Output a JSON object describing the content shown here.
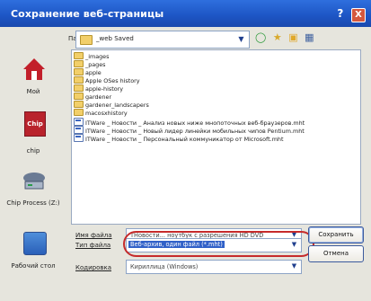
{
  "window": {
    "title": "Сохранение веб-страницы",
    "help": "?",
    "close": "X"
  },
  "lookin": {
    "label": "Папка",
    "value": "_web Saved"
  },
  "places": [
    {
      "label": "Мой",
      "icon": "home-icon"
    },
    {
      "label": "chip",
      "icon": "chip-icon"
    },
    {
      "label": "Chip Process (Z:)",
      "icon": "computer-icon"
    },
    {
      "label": "Рабочий стол",
      "icon": "desktop-icon"
    }
  ],
  "files": [
    {
      "type": "folder",
      "name": "_images"
    },
    {
      "type": "folder",
      "name": "_pages"
    },
    {
      "type": "folder",
      "name": "apple"
    },
    {
      "type": "folder",
      "name": "Apple OSes history"
    },
    {
      "type": "folder",
      "name": "apple-history"
    },
    {
      "type": "folder",
      "name": "gardener"
    },
    {
      "type": "folder",
      "name": "gardener_landscapers"
    },
    {
      "type": "folder",
      "name": "macosxhistory"
    },
    {
      "type": "mht",
      "name": "ITWare _ Новости _ Анализ новых ниже мнопоточных веб-браузеров.mht"
    },
    {
      "type": "mht",
      "name": "ITWare _ Новости _ Новый лидер линейки мобильных чипов Pentium.mht"
    },
    {
      "type": "mht",
      "name": "ITWare _ Новости _ Персональный коммуникатор от Microsoft.mht"
    }
  ],
  "form": {
    "filename_label": "Имя файла",
    "filename_value": "ТНовости... ноутбук с разрешения HD DVD",
    "filetype_label": "Тип файла",
    "filetype_value": "Веб-архив, один файл (*.mht)",
    "encoding_label": "Кодировка",
    "encoding_value": "Кириллица (Windows)"
  },
  "buttons": {
    "save": "Сохранить",
    "cancel": "Отмена"
  }
}
